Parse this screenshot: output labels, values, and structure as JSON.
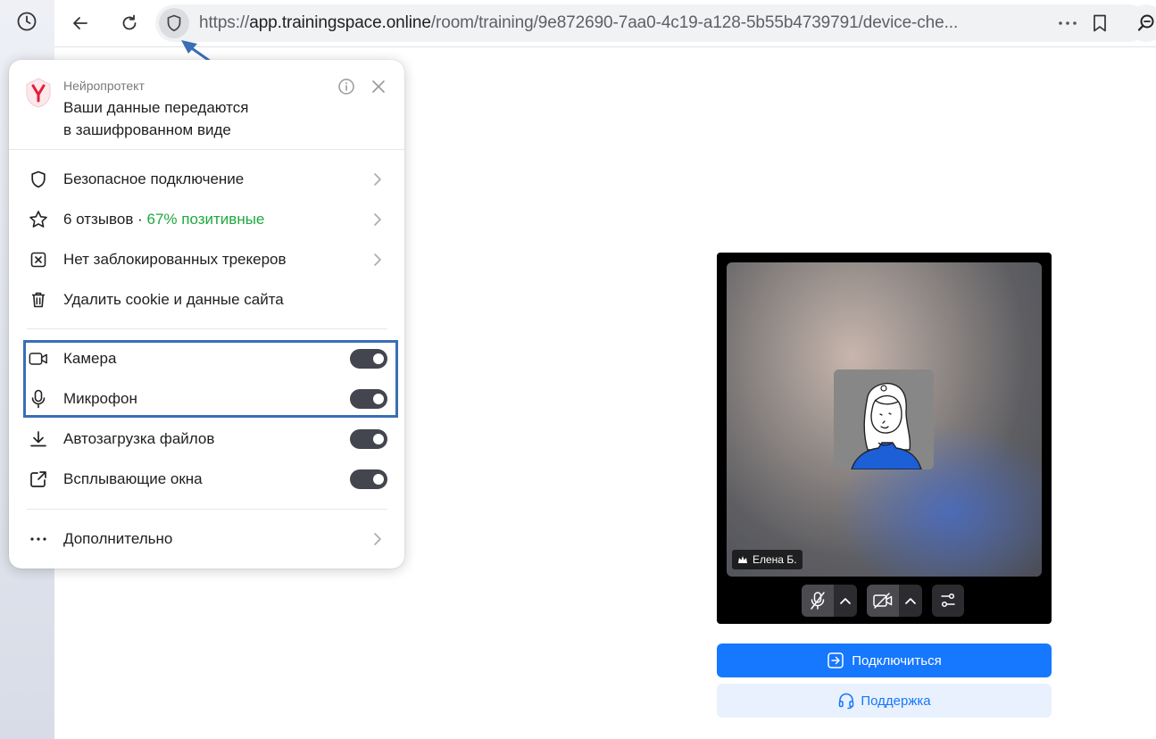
{
  "browser": {
    "url_prefix": "https://",
    "url_host": "app.trainingspace.online",
    "url_path": "/room/training/9e872690-7aa0-4c19-a128-5b55b4739791/device-che..."
  },
  "popup": {
    "brand": "Нейропротект",
    "headline_line1": "Ваши данные передаются",
    "headline_line2": "в зашифрованном виде",
    "items": [
      {
        "label": "Безопасное подключение",
        "icon": "shield-icon"
      },
      {
        "label_main": "6 отзывов · ",
        "label_accent": "67% позитивные",
        "icon": "star-icon"
      },
      {
        "label": "Нет заблокированных трекеров",
        "icon": "blocked-tracker-icon"
      },
      {
        "label": "Удалить cookie и данные сайта",
        "icon": "trash-icon"
      }
    ],
    "permissions": [
      {
        "label": "Камера",
        "icon": "camera-icon",
        "enabled": true
      },
      {
        "label": "Микрофон",
        "icon": "microphone-icon",
        "enabled": true
      },
      {
        "label": "Автозагрузка файлов",
        "icon": "download-icon",
        "enabled": true
      },
      {
        "label": "Всплывающие окна",
        "icon": "popup-window-icon",
        "enabled": true
      }
    ],
    "more_label": "Дополнительно"
  },
  "video": {
    "participant_name": "Елена Б."
  },
  "actions": {
    "join_label": "Подключиться",
    "support_label": "Поддержка"
  },
  "colors": {
    "accent": "#1677ff",
    "positive": "#1fa83f",
    "highlight": "#3a6eb5",
    "toggle_on": "#43464e"
  }
}
